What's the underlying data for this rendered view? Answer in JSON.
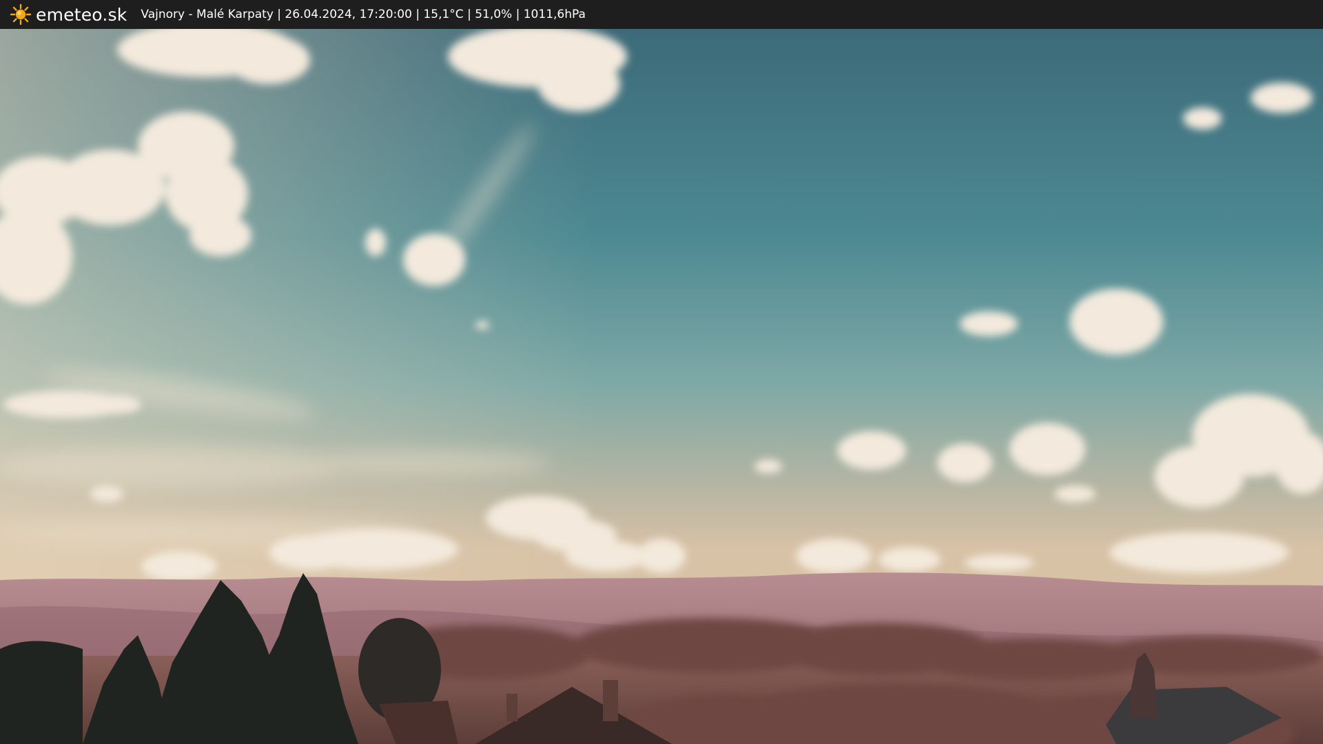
{
  "overlay": {
    "brand": "emeteo.sk",
    "caption": "Vajnory - Malé Karpaty | 26.04.2024, 17:20:00 | 15,1°C | 51,0% | 1011,6hPa",
    "logo_icon": "sun-icon"
  },
  "colors": {
    "bar": "#1e1e1e",
    "sun": "#f4a816",
    "sky_top": "#3f6f7d",
    "sky_mid": "#5f9ea4",
    "sky_horizon": "#cbb9a0",
    "cloud": "#f3e9dc",
    "hills": "#a57a80",
    "foreground": "#5a3c38",
    "trees": "#1f2420"
  }
}
